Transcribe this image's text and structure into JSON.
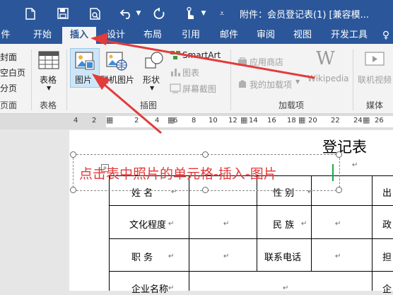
{
  "quick_access": {
    "icons": [
      "new-doc-icon",
      "save-icon",
      "print-preview-icon",
      "undo-icon",
      "undo-dropdown-icon",
      "redo-icon",
      "touch-mode-icon",
      "customize-qat-icon"
    ]
  },
  "window": {
    "title": "附件：会员登记表(1) [兼容模..."
  },
  "tabs": [
    {
      "label": "件"
    },
    {
      "label": "开始"
    },
    {
      "label": "插入"
    },
    {
      "label": "设计"
    },
    {
      "label": "布局"
    },
    {
      "label": "引用"
    },
    {
      "label": "邮件"
    },
    {
      "label": "审阅"
    },
    {
      "label": "视图"
    },
    {
      "label": "开发工具"
    }
  ],
  "ribbon": {
    "pages_items": [
      "封面",
      "空白页",
      "分页"
    ],
    "pages_group": "页面",
    "table_label": "表格",
    "table_group": "表格",
    "picture_label": "图片",
    "online_picture_label": "联机图片",
    "shapes_label": "形状",
    "smartart_label": "SmartArt",
    "chart_label": "图表",
    "screenshot_label": "屏幕截图",
    "illustrations_group": "插图",
    "store_label": "应用商店",
    "my_addins_label": "我的加载项",
    "wikipedia_label": "Wikipedia",
    "addins_group": "加载项",
    "online_video_label": "联机视频",
    "media_group": "媒体"
  },
  "ruler": {
    "numbers": [
      "4",
      "2",
      "2",
      "4",
      "6",
      "8",
      "10",
      "12",
      "14",
      "16",
      "18",
      "20",
      "22",
      "24",
      "26"
    ]
  },
  "document": {
    "heading": "登记表",
    "annotation": "点击表中照片的单元格-插入-图片",
    "rows": [
      [
        "姓    名",
        "",
        "性  别",
        "",
        "出"
      ],
      [
        "文化程度",
        "",
        "民  族",
        "",
        "政"
      ],
      [
        "职    务",
        "",
        "联系电话",
        "",
        "担"
      ],
      [
        "企业名称",
        "",
        "",
        "",
        "企"
      ]
    ]
  },
  "colors": {
    "title_bar": "#2b579a",
    "ribbon_bg": "#f3f3f3",
    "annotation_red": "#e23b3b"
  }
}
